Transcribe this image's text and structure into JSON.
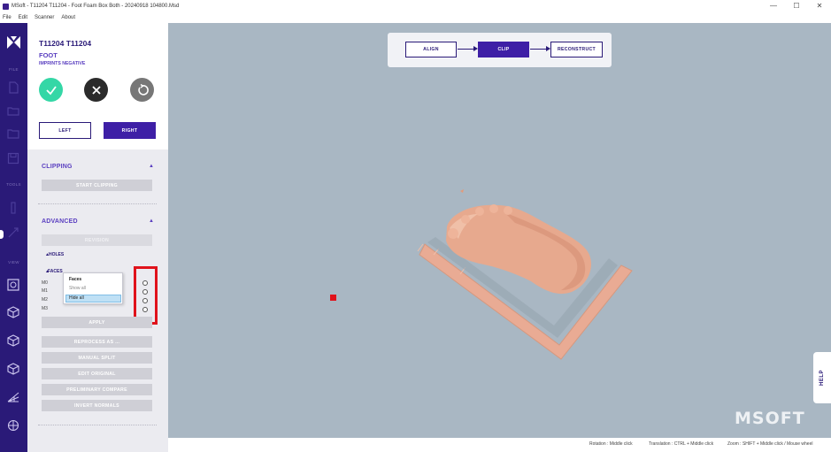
{
  "window": {
    "title": "MSoft - T11204 T11204 - Foot Foam Box Both - 20240918 104800.Msd",
    "controls": [
      "—",
      "☐",
      "✕"
    ]
  },
  "menu": [
    "File",
    "Edit",
    "Scanner",
    "About"
  ],
  "rail": {
    "sections": {
      "file": "FILE",
      "tools": "TOOLS",
      "view": "VIEW"
    }
  },
  "panel": {
    "patient": "T11204 T11204",
    "item": "FOOT",
    "subtitle": "IMPRINTS NEGATIVE",
    "side_buttons": {
      "left": "LEFT",
      "right": "RIGHT"
    },
    "clipping": {
      "title": "CLIPPING",
      "start_button": "START CLIPPING"
    },
    "advanced": {
      "title": "ADVANCED",
      "button_dim": "REVISION",
      "holes_label": "HOLES",
      "faces_label": "FACES",
      "mesh_labels": [
        "M0",
        "M1",
        "M2",
        "M3"
      ],
      "apply": "APPLY",
      "buttons": [
        "REPROCESS AS ...",
        "MANUAL SPLIT",
        "EDIT ORIGINAL",
        "PRELIMINARY COMPARE",
        "INVERT NORMALS"
      ]
    },
    "context_menu": {
      "header": "Faces",
      "items": [
        "Show all",
        "Hide all"
      ]
    }
  },
  "workflow": {
    "steps": [
      "ALIGN",
      "CLIP",
      "RECONSTRUCT"
    ],
    "active": "CLIP"
  },
  "viewport": {
    "help_label": "HELP",
    "brand": "MSOFT"
  },
  "statusbar": {
    "rotation": "Rotation : Middle click",
    "translation": "Translation : CTRL + Middle click",
    "zoom": "Zoom : SHIFT + Middle click / Mouse wheel"
  },
  "colors": {
    "accent": "#3e1fa6",
    "rail": "#2a1a78",
    "ok": "#34d7a6",
    "highlight": "#e0121b",
    "viewport_bg": "#a9b7c3"
  }
}
